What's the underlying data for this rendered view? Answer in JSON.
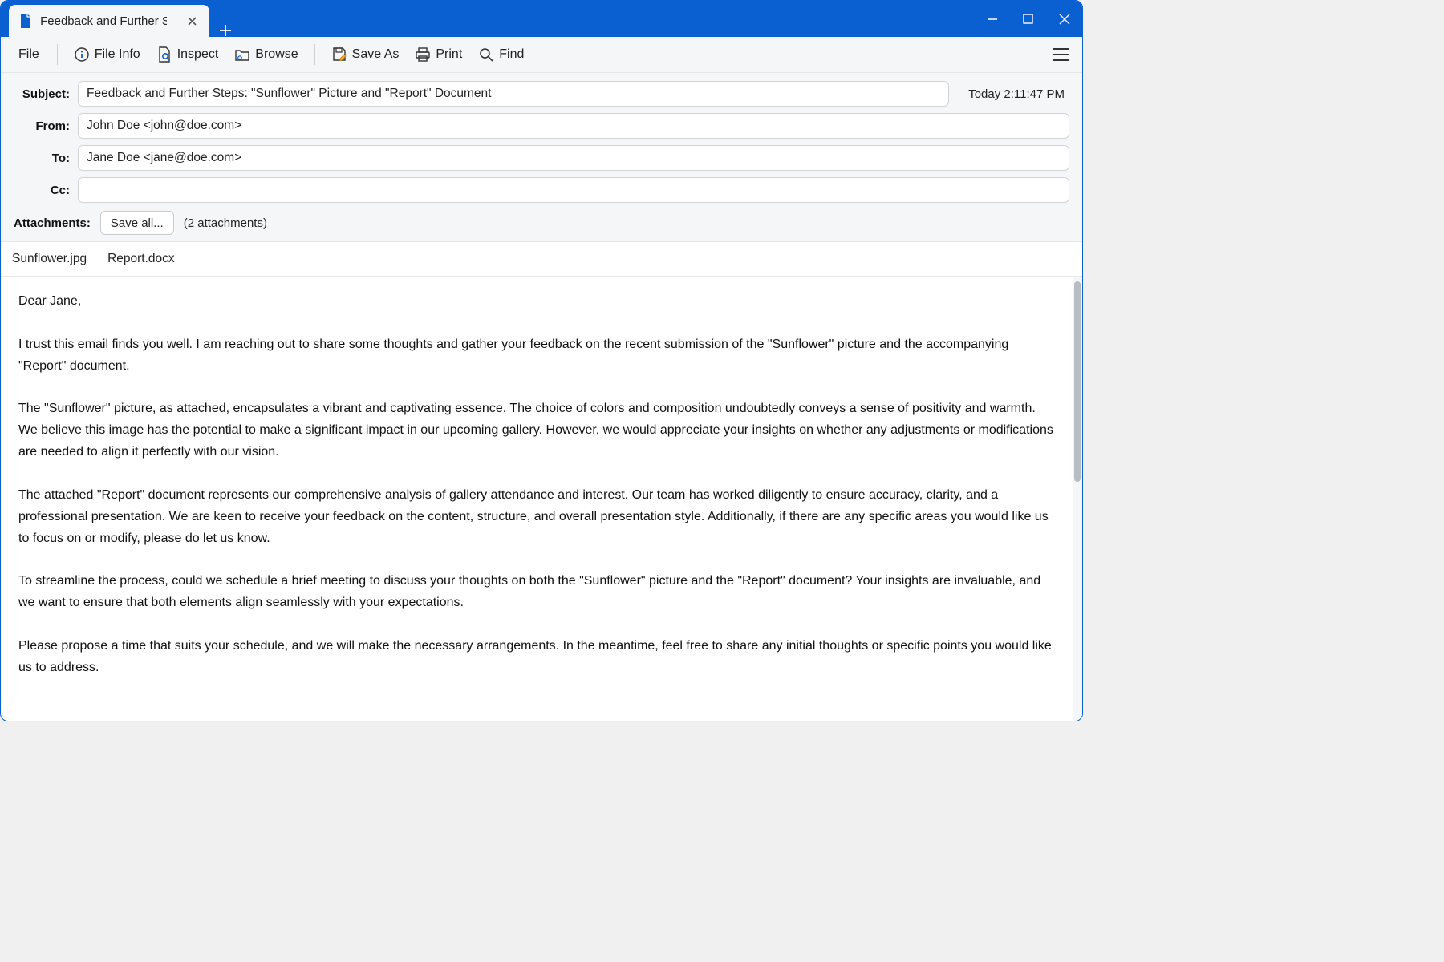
{
  "titlebar": {
    "tab_title": "Feedback and Further St"
  },
  "toolbar": {
    "file": "File",
    "file_info": "File Info",
    "inspect": "Inspect",
    "browse": "Browse",
    "save_as": "Save As",
    "print": "Print",
    "find": "Find"
  },
  "hdr": {
    "subject_label": "Subject:",
    "subject_value": "Feedback and Further Steps: \"Sunflower\" Picture and \"Report\" Document",
    "timestamp": "Today 2:11:47 PM",
    "from_label": "From:",
    "from_value": "John Doe <john@doe.com>",
    "to_label": "To:",
    "to_value": "Jane Doe <jane@doe.com>",
    "cc_label": "Cc:",
    "cc_value": ""
  },
  "att": {
    "label": "Attachments:",
    "save_all": "Save all...",
    "count": "(2 attachments)",
    "items": [
      "Sunflower.jpg",
      "Report.docx"
    ]
  },
  "body": "Dear Jane,\n\nI trust this email finds you well. I am reaching out to share some thoughts and gather your feedback on the recent submission of the \"Sunflower\" picture and the accompanying \"Report\" document.\n\nThe \"Sunflower\" picture, as attached, encapsulates a vibrant and captivating essence. The choice of colors and composition undoubtedly conveys a sense of positivity and warmth. We believe this image has the potential to make a significant impact in our upcoming gallery. However, we would appreciate your insights on whether any adjustments or modifications are needed to align it perfectly with our vision.\n\nThe attached \"Report\" document represents our comprehensive analysis of gallery attendance and interest. Our team has worked diligently to ensure accuracy, clarity, and a professional presentation. We are keen to receive your feedback on the content, structure, and overall presentation style. Additionally, if there are any specific areas you would like us to focus on or modify, please do let us know.\n\nTo streamline the process, could we schedule a brief meeting to discuss your thoughts on both the \"Sunflower\" picture and the \"Report\" document? Your insights are invaluable, and we want to ensure that both elements align seamlessly with your expectations.\n\nPlease propose a time that suits your schedule, and we will make the necessary arrangements. In the meantime, feel free to share any initial thoughts or specific points you would like us to address."
}
